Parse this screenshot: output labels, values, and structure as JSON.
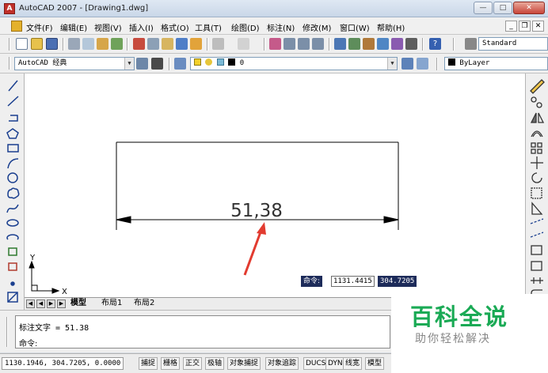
{
  "window": {
    "title": "AutoCAD 2007 - [Drawing1.dwg]",
    "app_icon_letter": "A"
  },
  "menubar": {
    "items": [
      "文件(F)",
      "编辑(E)",
      "视图(V)",
      "插入(I)",
      "格式(O)",
      "工具(T)",
      "绘图(D)",
      "标注(N)",
      "修改(M)",
      "窗口(W)",
      "帮助(H)"
    ]
  },
  "toolbar_styles": {
    "text_style": "Standard"
  },
  "toolbar_workspace": {
    "workspace": "AutoCAD 经典",
    "layer": "0",
    "linetype": "ByLayer"
  },
  "drawing": {
    "dimension_text": "51,38",
    "ucs_x": "X",
    "ucs_y": "Y"
  },
  "dynamic_input": {
    "label": "命令:",
    "x_value": "1131.4415",
    "y_value": "304.7205"
  },
  "layout_tabs": [
    "模型",
    "布局1",
    "布局2"
  ],
  "command_window": {
    "history_line": "标注文字 = 51.38",
    "prompt": "命令:"
  },
  "statusbar": {
    "coordinates": "1130.1946, 304.7205, 0.0000",
    "toggles": [
      "捕捉",
      "栅格",
      "正交",
      "极轴",
      "对象捕捉",
      "对象追踪",
      "DUCS",
      "DYN",
      "线宽",
      "模型"
    ]
  },
  "watermark": {
    "line1": "百科全说",
    "line2": "助你轻松解决"
  },
  "colors": {
    "annotation_arrow": "#e23b30",
    "dimension_line": "#000000",
    "watermark_green": "#1aaa55",
    "dynamic_label_bg": "#1d2b5a"
  },
  "icons": {
    "left_toolbar": [
      "line-icon",
      "construction-line-icon",
      "polyline-icon",
      "polygon-icon",
      "rectangle-icon",
      "arc-icon",
      "circle-icon",
      "revision-cloud-icon",
      "spline-icon",
      "ellipse-icon",
      "ellipse-arc-icon",
      "insert-block-icon",
      "make-block-icon",
      "point-icon",
      "hatch-icon"
    ],
    "right_toolbar": [
      "erase-icon",
      "copy-icon",
      "mirror-icon",
      "offset-icon",
      "array-icon",
      "move-icon",
      "rotate-icon",
      "scale-icon",
      "stretch-icon",
      "trim-icon",
      "extend-icon",
      "break-icon",
      "join-icon",
      "chamfer-icon",
      "fillet-icon",
      "explode-icon"
    ]
  }
}
